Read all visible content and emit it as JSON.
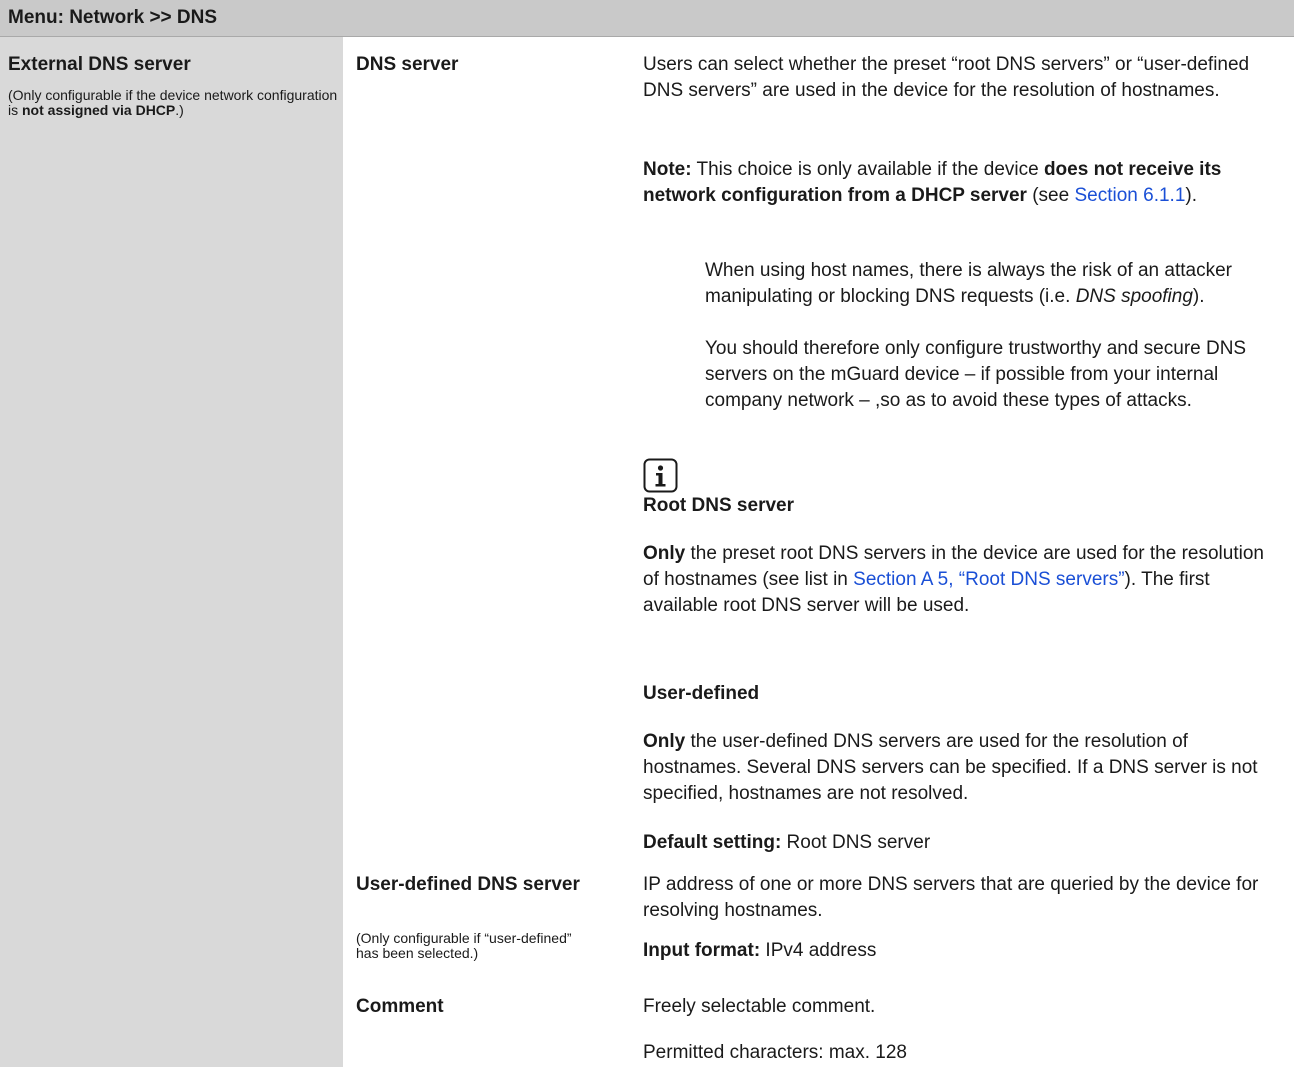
{
  "header": {
    "title": "Menu: Network >> DNS"
  },
  "section": {
    "title": "External DNS server",
    "note": {
      "pre": "(Only configurable if the device net­work configuration is ",
      "bold": "not assigned via DHCP",
      "post": ".)"
    }
  },
  "fields": {
    "dns_server": {
      "name": "DNS server",
      "desc": "Users can select whether the preset “root DNS servers” or “user-defined DNS servers” are used in the device for the res­olution of hostnames.",
      "note_label": "Note:",
      "note_pre": " This choice is only available if the device ",
      "note_bold": "does not re­ceive its network configuration from a DHCP server",
      "note_mid": " (see ",
      "note_link": "Section 6.1.1",
      "note_post": ").",
      "info": {
        "icon": "info-icon",
        "text_pre": "When using host names, there is always the risk of an at­tacker manipulating or blocking DNS requests (i.e. ",
        "text_em": "DNS spoofing",
        "text_post": ").",
        "text2": "You should therefore only configure trustworthy and se­cure DNS servers on the mGuard device – if possible from your internal company network – ,so as to avoid these types of attacks."
      },
      "root": {
        "title": "Root DNS server",
        "only": "Only",
        "desc_pre": " the preset root DNS servers in the device are used for the resolution of hostnames (see list in ",
        "link": "Section A 5, “Root DNS servers”",
        "desc_post": "). The first available root DNS server will be used."
      },
      "user": {
        "title": "User-defined",
        "only": "Only",
        "desc": " the user-defined DNS servers are used for the resolution of hostnames. Several DNS servers can be specified. If a DNS server is not specified, hostnames are not resolved."
      },
      "default_label": "Default setting:",
      "default_value": " Root DNS server"
    },
    "user_defined_dns": {
      "name": "User-defined DNS server",
      "note": "(Only configurable if “user-defined” has been selected.)",
      "desc": "IP address of one or more DNS servers that are queried by the device for resolving hostnames.",
      "format_label": "Input format:",
      "format_value": " IPv4 address"
    },
    "comment": {
      "name": "Comment",
      "desc": "Freely selectable comment.",
      "permitted": "Permitted characters: max. 128"
    }
  },
  "colors": {
    "header_bg": "#c9c9c9",
    "left_col_bg": "#d9d9d9",
    "link": "#1a4fd6"
  }
}
